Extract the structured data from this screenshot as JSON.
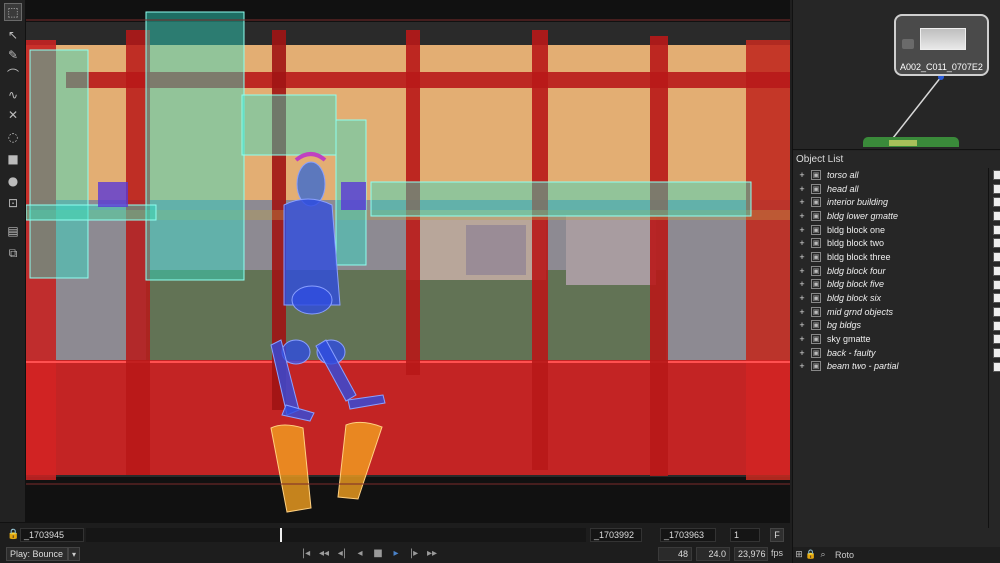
{
  "toolbar": {
    "icons": [
      "transform-icon",
      "arrow-icon",
      "pen-icon",
      "bspline-icon",
      "bezier-icon",
      "xspline-icon",
      "magnetic-icon",
      "brush-icon",
      "rectangle-icon",
      "circle-icon",
      "move-points-icon",
      "keyframe-icon",
      "layers-icon"
    ]
  },
  "node": {
    "label": "A002_C011_0707E2"
  },
  "object_list": {
    "title": "Object List",
    "items": [
      {
        "name": "torso all",
        "italic": true
      },
      {
        "name": "head all",
        "italic": true
      },
      {
        "name": "interior building",
        "italic": true
      },
      {
        "name": "bldg lower gmatte",
        "italic": true
      },
      {
        "name": "bldg block one",
        "italic": false
      },
      {
        "name": "bldg block two",
        "italic": false
      },
      {
        "name": "bldg block three",
        "italic": false
      },
      {
        "name": "bldg block four",
        "italic": true
      },
      {
        "name": "bldg block five",
        "italic": true
      },
      {
        "name": "bldg block six",
        "italic": true
      },
      {
        "name": "mid grnd objects",
        "italic": true
      },
      {
        "name": "bg bldgs",
        "italic": true
      },
      {
        "name": "sky gmatte",
        "italic": false
      },
      {
        "name": "back - faulty",
        "italic": true
      },
      {
        "name": "beam two - partial",
        "italic": true
      }
    ]
  },
  "right_footer": {
    "label": "Roto"
  },
  "timeline": {
    "start_frame": "_1703945",
    "end_frame": "_1703992",
    "current_frame": "_1703963",
    "step": "1",
    "f_button": "F",
    "play_mode": "Play: Bounce",
    "frame_count": "48",
    "fps_value": "24.0",
    "actual_fps": "23,976",
    "fps_label": "fps"
  },
  "colors": {
    "sky": "#e3ae73",
    "beam_red": "#c41a1a",
    "shape_cyan": "#2fe0c8",
    "shape_blue": "#2f4ce0",
    "shape_orange": "#f2a020",
    "floor_red": "#d42424"
  }
}
